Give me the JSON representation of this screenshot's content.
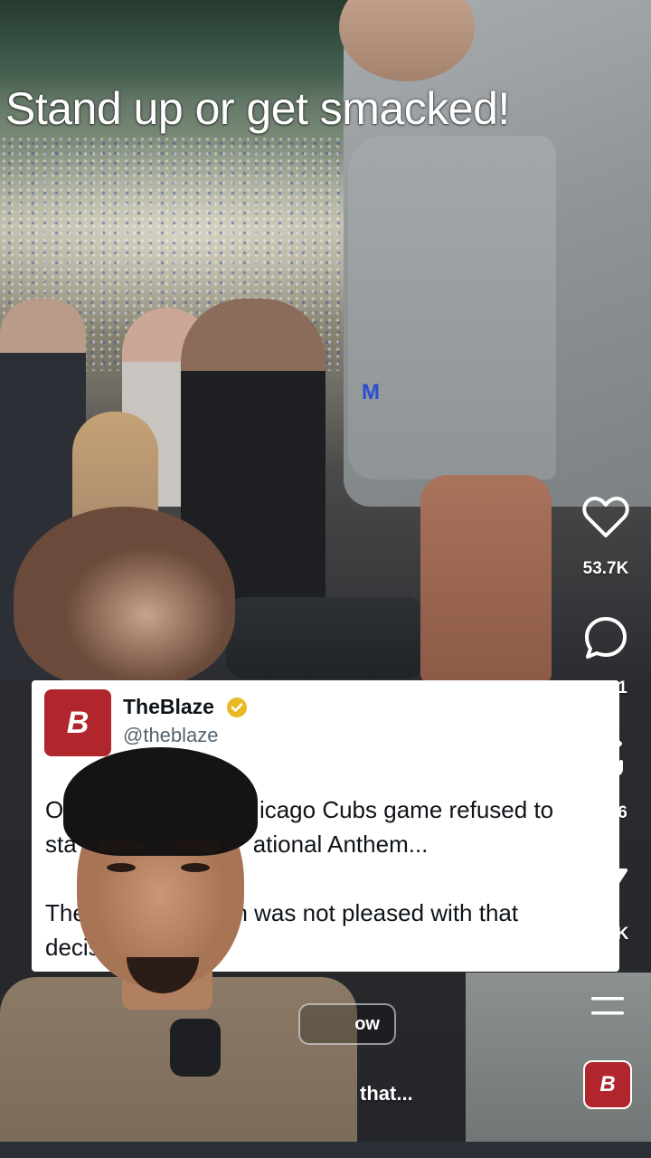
{
  "video": {
    "caption": "Stand up or get smacked!"
  },
  "actions": {
    "like_count": "53.7K",
    "comment_count": "5,281",
    "repost_count": "1,346",
    "share_count": "16.1K"
  },
  "tweet": {
    "logo_text": "B",
    "name": "TheBlaze",
    "handle": "@theblaze",
    "line1": "On                            icago Cubs game refused to",
    "line2": "sta                           ational Anthem...",
    "line3": "The                     im was not pleased with that",
    "line4": "decis"
  },
  "overlay": {
    "follow_label": "ow",
    "description_tail": "that..."
  },
  "account": {
    "avatar_text": "B"
  },
  "colors": {
    "brand_red": "#b0262c",
    "verified_gold": "#e8b923"
  }
}
